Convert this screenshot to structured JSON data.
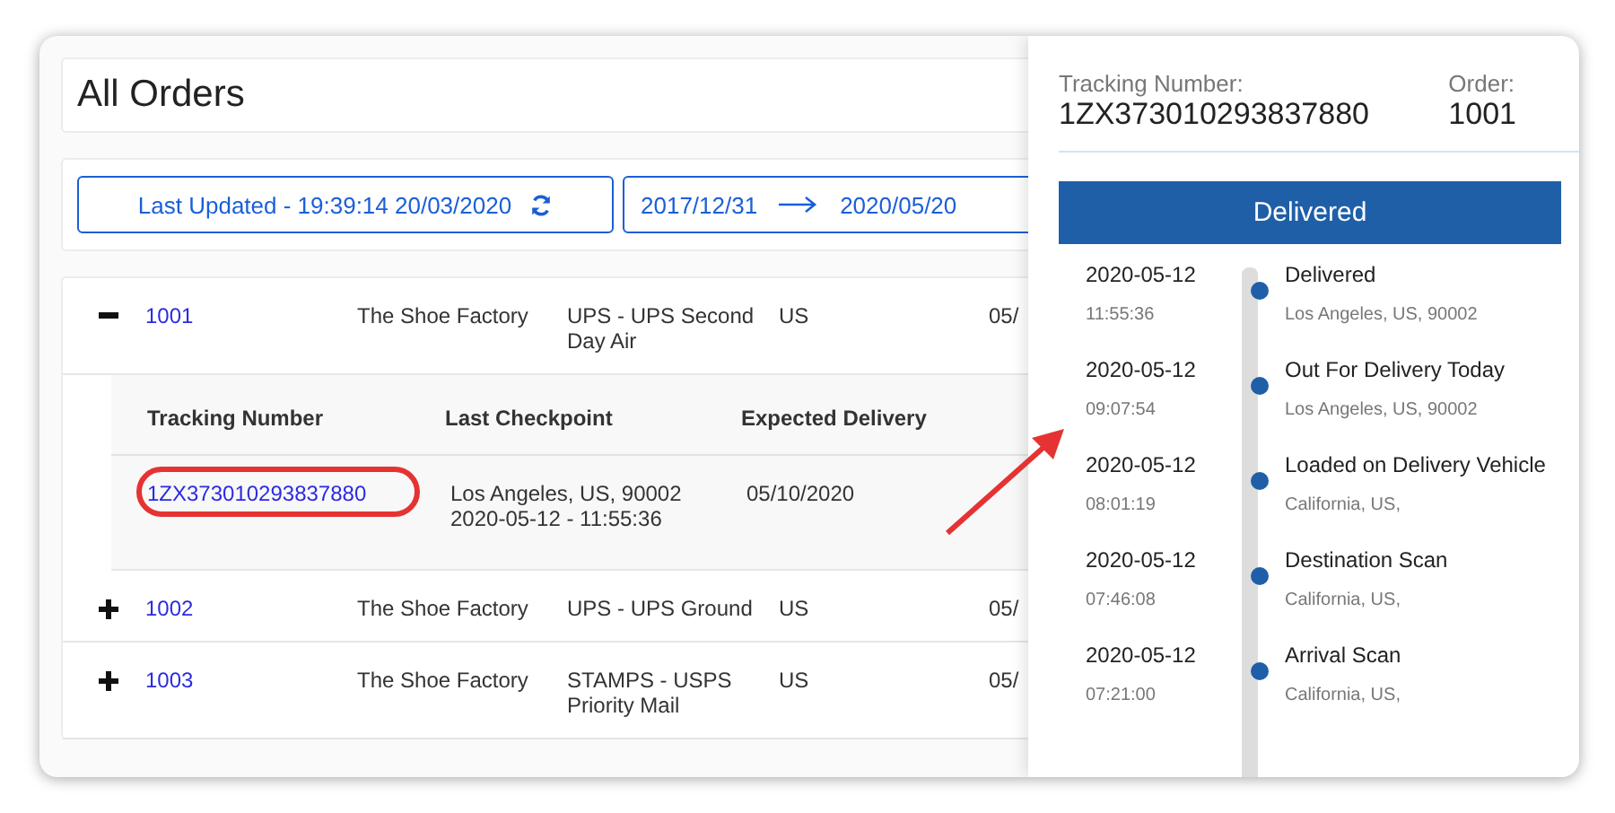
{
  "page": {
    "title": "All Orders"
  },
  "filters": {
    "last_updated": "Last Updated - 19:39:14 20/03/2020",
    "date_from": "2017/12/31",
    "date_to": "2020/05/20"
  },
  "orders": [
    {
      "id": "1001",
      "store": "The Shoe Factory",
      "carrier": "UPS - UPS Second Day Air",
      "country": "US",
      "column_5": "05/",
      "expanded": true,
      "shipments": {
        "columns": [
          "Tracking Number",
          "Last Checkpoint",
          "Expected Delivery"
        ],
        "rows": [
          {
            "tracking_number": "1ZX373010293837880",
            "checkpoint": "Los Angeles, US, 90002",
            "checkpoint_time": "2020-05-12 - 11:55:36",
            "expected": "05/10/2020",
            "circled": true
          }
        ]
      }
    },
    {
      "id": "1002",
      "store": "The Shoe Factory",
      "carrier": "UPS - UPS Ground",
      "country": "US",
      "column_5": "05/",
      "expanded": false
    },
    {
      "id": "1003",
      "store": "The Shoe Factory",
      "carrier": "STAMPS - USPS Priority Mail",
      "country": "US",
      "column_5": "05/",
      "expanded": false
    }
  ],
  "tracking_panel": {
    "tracking_label": "Tracking Number:",
    "tracking_number": "1ZX373010293837880",
    "order_label": "Order:",
    "order_number": "1001",
    "status": "Delivered",
    "events": [
      {
        "date": "2020-05-12",
        "time": "11:55:36",
        "status": "Delivered",
        "location": "Los Angeles, US, 90002"
      },
      {
        "date": "2020-05-12",
        "time": "09:07:54",
        "status": "Out For Delivery Today",
        "location": "Los Angeles, US, 90002"
      },
      {
        "date": "2020-05-12",
        "time": "08:01:19",
        "status": "Loaded on Delivery Vehicle",
        "location": "California, US,"
      },
      {
        "date": "2020-05-12",
        "time": "07:46:08",
        "status": "Destination Scan",
        "location": "California, US,"
      },
      {
        "date": "2020-05-12",
        "time": "07:21:00",
        "status": "Arrival Scan",
        "location": "California, US,"
      }
    ]
  }
}
